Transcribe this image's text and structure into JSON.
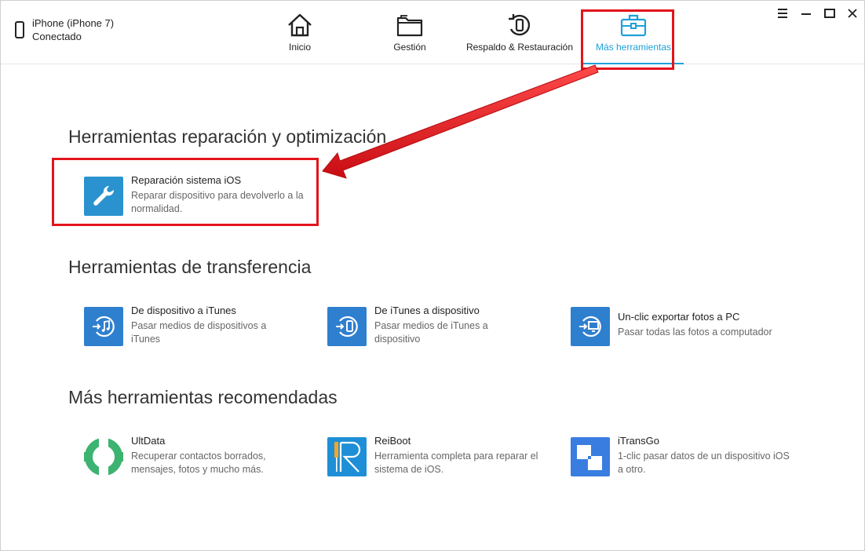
{
  "device": {
    "name": "iPhone (iPhone 7)",
    "status": "Conectado"
  },
  "nav": {
    "tabs": [
      {
        "label": "Inicio",
        "icon": "home-icon"
      },
      {
        "label": "Gestión",
        "icon": "folder-icon"
      },
      {
        "label": "Respaldo & Restauración",
        "icon": "backup-restore-icon"
      },
      {
        "label": "Más herramientas",
        "icon": "toolbox-icon",
        "active": true
      }
    ]
  },
  "window_controls": [
    "menu-icon",
    "minimize-icon",
    "maximize-icon",
    "close-icon"
  ],
  "sections": {
    "repair": {
      "title": "Herramientas reparación y optimización",
      "items": [
        {
          "title": "Reparación sistema iOS",
          "desc": "Reparar dispositivo para devolverlo a la normalidad.",
          "icon": "wrench-icon"
        }
      ]
    },
    "transfer": {
      "title": "Herramientas de transferencia",
      "items": [
        {
          "title": "De dispositivo a iTunes",
          "desc": "Pasar medios de dispositivos a iTunes",
          "icon": "device-to-itunes-icon"
        },
        {
          "title": "De iTunes a dispositivo",
          "desc": "Pasar medios de iTunes a dispositivo",
          "icon": "itunes-to-device-icon"
        },
        {
          "title": "Un-clic exportar fotos a PC",
          "desc": "Pasar todas las fotos a computador",
          "icon": "export-photos-icon"
        }
      ]
    },
    "recommended": {
      "title": "Más herramientas recomendadas",
      "items": [
        {
          "title": "UltData",
          "desc": "Recuperar contactos borrados, mensajes, fotos y mucho más.",
          "icon": "ultdata-icon"
        },
        {
          "title": "ReiBoot",
          "desc": "Herramienta completa para reparar  el sistema de iOS.",
          "icon": "reiboot-icon"
        },
        {
          "title": "iTransGo",
          "desc": "1-clic pasar datos de un dispositivo iOS a otro.",
          "icon": "itransgo-icon"
        }
      ]
    }
  },
  "colors": {
    "accent": "#1da1d9",
    "annotation": "#e3141b",
    "transfer_icon": "#2f7fcf",
    "ultdata": "#3cb371",
    "reiboot": "#1e8fd6",
    "itransgo": "#3a7de0"
  }
}
